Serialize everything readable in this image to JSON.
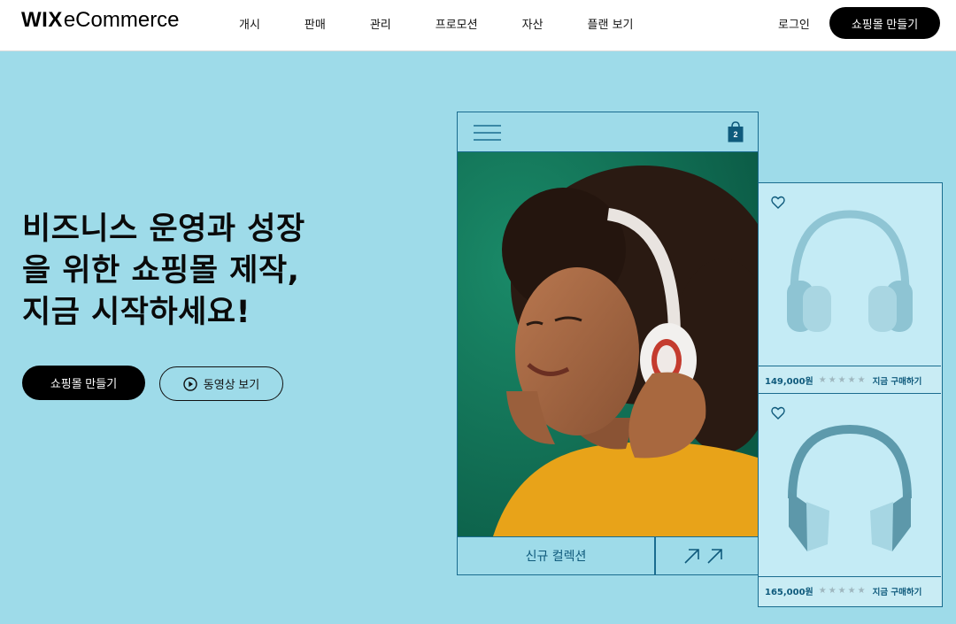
{
  "header": {
    "logo_brand": "WIX",
    "logo_product": "eCommerce",
    "nav": [
      "개시",
      "판매",
      "관리",
      "프로모션",
      "자산",
      "플랜 보기"
    ],
    "login": "로그인",
    "cta": "쇼핑몰 만들기"
  },
  "hero": {
    "title_lines": [
      "비즈니스 운영과 성장",
      "을 위한 쇼핑몰 제작,",
      "지금 시작하세요!"
    ],
    "primary_button": "쇼핑몰 만들기",
    "video_button": "동영상 보기"
  },
  "mockup": {
    "cart_count": "2",
    "collection_label": "신규 컬렉션",
    "products": [
      {
        "price": "149,000원",
        "stars": "★★★★★",
        "buy": "지금 구매하기"
      },
      {
        "price": "165,000원",
        "stars": "★★★★★",
        "buy": "지금 구매하기"
      }
    ]
  },
  "colors": {
    "background": "#9edbe9",
    "mockup_line": "#1a6c8f",
    "photo_bg": "#0f6f55",
    "sweater": "#e8a319"
  },
  "icons": [
    "menu-icon",
    "shopping-bag-icon",
    "play-icon",
    "heart-icon",
    "arrow-up-right-icon"
  ]
}
